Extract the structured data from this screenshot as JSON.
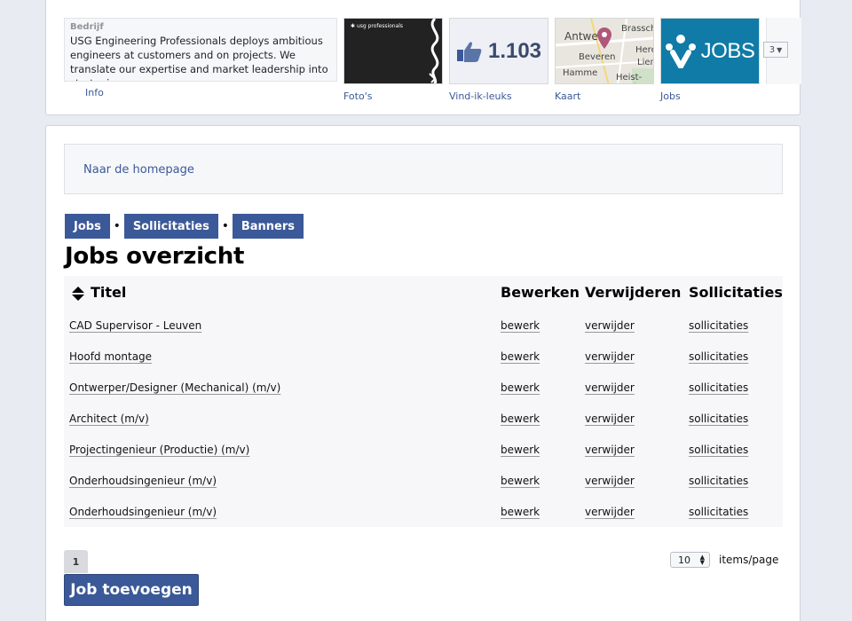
{
  "about": {
    "label": "Bedrijf",
    "text": "USG Engineering Professionals deploys ambitious engineers at customers and on projects. We translate our expertise and market leadership into strategic",
    "link": "Info"
  },
  "tiles": {
    "photos": {
      "caption": "Foto's",
      "logo_text": "usg professionals"
    },
    "likes": {
      "caption": "Vind-ik-leuks",
      "count": "1.103"
    },
    "map": {
      "caption": "Kaart",
      "places": [
        "Antwerp",
        "Brasschaat",
        "Beveren",
        "Here",
        "Hamme",
        "Lier",
        "Heist-op-d"
      ]
    },
    "jobs": {
      "caption": "Jobs",
      "label": "JOBS"
    },
    "more_count": "3"
  },
  "homepage_link": "Naar de homepage",
  "tabs": [
    "Jobs",
    "Sollicitaties",
    "Banners"
  ],
  "page_title": "Jobs overzicht",
  "table": {
    "headers": {
      "title": "Titel",
      "edit": "Bewerken",
      "delete": "Verwijderen",
      "applications": "Sollicitaties"
    },
    "rows": [
      {
        "title": "CAD Supervisor - Leuven",
        "edit": "bewerk",
        "delete": "verwijder",
        "applications": "sollicitaties"
      },
      {
        "title": "Hoofd montage",
        "edit": "bewerk",
        "delete": "verwijder",
        "applications": "sollicitaties"
      },
      {
        "title": "Ontwerper/Designer (Mechanical) (m/v)",
        "edit": "bewerk",
        "delete": "verwijder",
        "applications": "sollicitaties"
      },
      {
        "title": "Architect (m/v)",
        "edit": "bewerk",
        "delete": "verwijder",
        "applications": "sollicitaties"
      },
      {
        "title": "Projectingenieur (Productie) (m/v)",
        "edit": "bewerk",
        "delete": "verwijder",
        "applications": "sollicitaties"
      },
      {
        "title": "Onderhoudsingenieur (m/v)",
        "edit": "bewerk",
        "delete": "verwijder",
        "applications": "sollicitaties"
      },
      {
        "title": "Onderhoudsingenieur (m/v)",
        "edit": "bewerk",
        "delete": "verwijder",
        "applications": "sollicitaties"
      }
    ]
  },
  "pager": {
    "current_page": "1",
    "per_page": "10",
    "per_page_label": "items/page"
  },
  "add_button": "Job toevoegen",
  "colors": {
    "accent": "#3b5998",
    "jobs_tile": "#0f7ba6"
  }
}
